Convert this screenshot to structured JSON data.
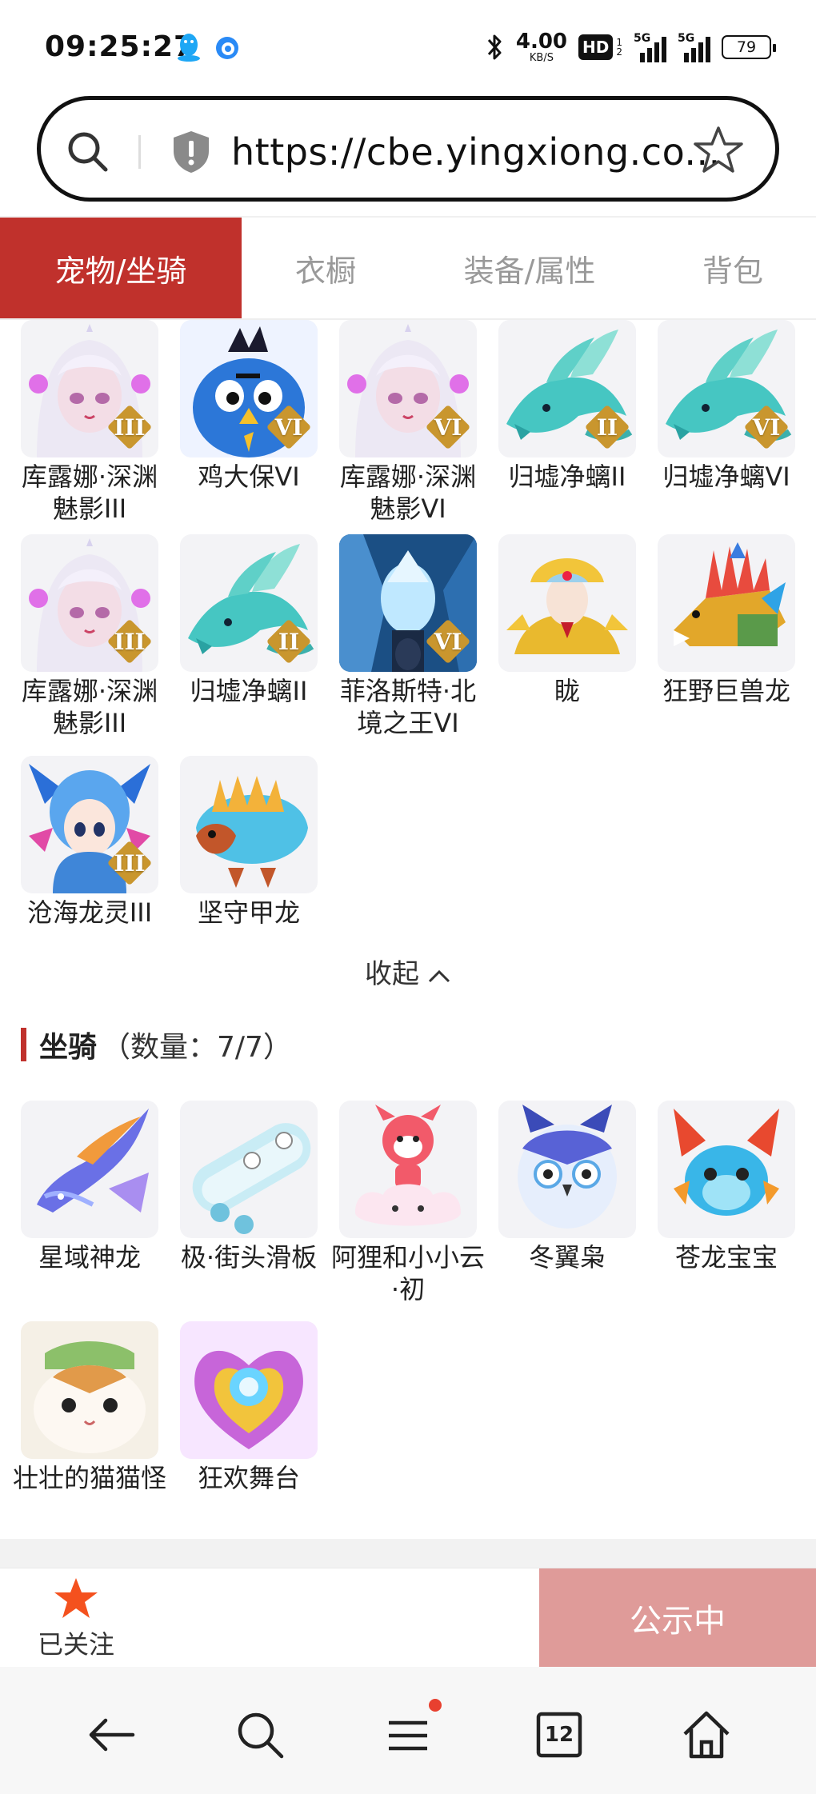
{
  "status": {
    "time": "09:25:27",
    "speed_value": "4.00",
    "speed_unit": "KB/S",
    "hd": "HD",
    "hd_sub_top": "1",
    "hd_sub_bottom": "2",
    "sim1": "5G",
    "sim2": "5G",
    "battery": "79"
  },
  "url_bar": {
    "url": "https://cbe.yingxiong.co..."
  },
  "tabs": [
    {
      "label": "宠物/坐骑",
      "active": true
    },
    {
      "label": "衣橱",
      "active": false
    },
    {
      "label": "装备/属性",
      "active": false
    },
    {
      "label": "背包",
      "active": false
    }
  ],
  "pets": [
    {
      "name": "库露娜·深渊魅影III",
      "tier": "III",
      "icon": "white-haired-girl"
    },
    {
      "name": "鸡大保VI",
      "tier": "VI",
      "icon": "blue-bird"
    },
    {
      "name": "库露娜·深渊魅影VI",
      "tier": "VI",
      "icon": "white-haired-girl"
    },
    {
      "name": "归墟净螭II",
      "tier": "II",
      "icon": "teal-dragon"
    },
    {
      "name": "归墟净螭VI",
      "tier": "VI",
      "icon": "teal-dragon"
    },
    {
      "name": "库露娜·深渊魅影III",
      "tier": "III",
      "icon": "white-haired-girl"
    },
    {
      "name": "归墟净螭II",
      "tier": "II",
      "icon": "teal-dragon"
    },
    {
      "name": "菲洛斯特·北境之王VI",
      "tier": "VI",
      "icon": "ice-king"
    },
    {
      "name": "眬",
      "tier": "",
      "icon": "golden-deity"
    },
    {
      "name": "狂野巨兽龙",
      "tier": "",
      "icon": "wild-dragon"
    },
    {
      "name": "沧海龙灵III",
      "tier": "III",
      "icon": "sea-dragon-spirit"
    },
    {
      "name": "坚守甲龙",
      "tier": "",
      "icon": "armored-dragon"
    }
  ],
  "collapse_label": "收起",
  "mounts_section": {
    "title": "坐骑",
    "count": "（数量：7/7）"
  },
  "mounts": [
    {
      "name": "星域神龙",
      "icon": "star-dragon"
    },
    {
      "name": "极·街头滑板",
      "icon": "skateboard"
    },
    {
      "name": "阿狸和小小云·初",
      "icon": "red-fox-cloud"
    },
    {
      "name": "冬翼枭",
      "icon": "winter-owl"
    },
    {
      "name": "苍龙宝宝",
      "icon": "baby-dragon"
    },
    {
      "name": "壮壮的猫猫怪",
      "icon": "cat-monster"
    },
    {
      "name": "狂欢舞台",
      "icon": "carnival-stage"
    }
  ],
  "action_bar": {
    "follow_label": "已关注",
    "public_label": "公示中"
  },
  "nav": {
    "tab_count": "12"
  },
  "colors": {
    "accent": "#c0312c",
    "public_button": "#df9b99",
    "follow_star": "#f4511e",
    "tier_gold": "#c9962e"
  }
}
